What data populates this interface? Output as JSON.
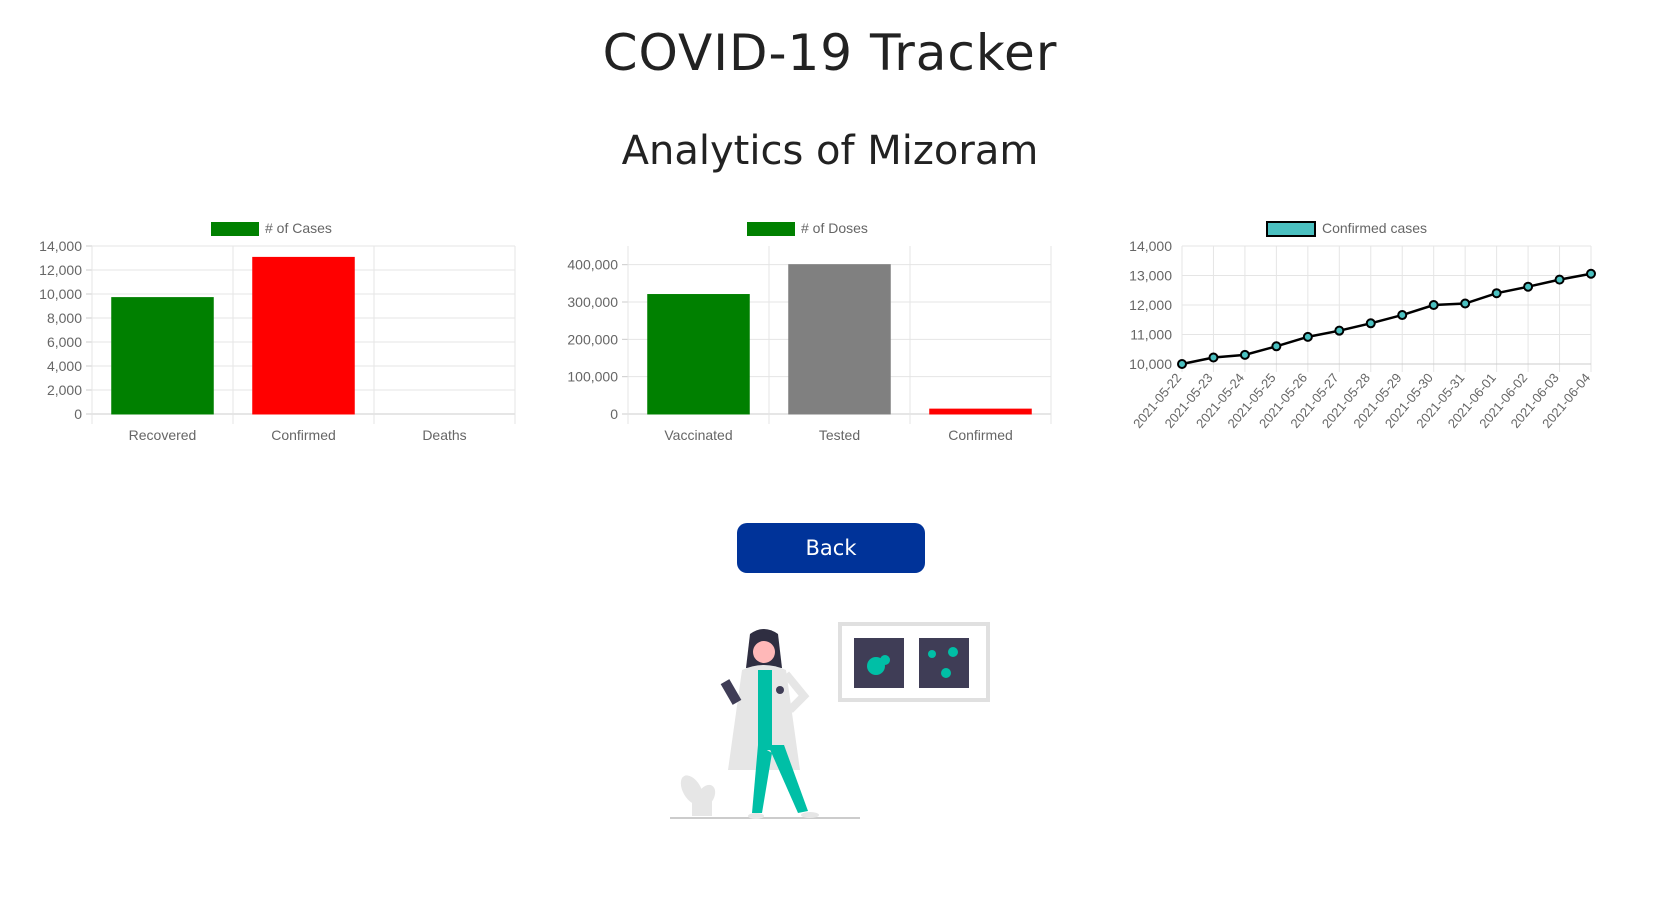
{
  "header": {
    "title": "COVID-19 Tracker",
    "subtitle": "Analytics of Mizoram"
  },
  "actions": {
    "back_label": "Back"
  },
  "colors": {
    "green": "#008000",
    "red": "#ff0000",
    "gray": "#808080",
    "teal": "#4bc0c0",
    "button": "#003399"
  },
  "chart_data": [
    {
      "type": "bar",
      "legend": "# of Cases",
      "categories": [
        "Recovered",
        "Confirmed",
        "Deaths"
      ],
      "values": [
        9700,
        13050,
        0
      ],
      "colors": [
        "#008000",
        "#ff0000",
        "#ff0000"
      ],
      "ylim": [
        0,
        14000
      ],
      "yticks": [
        0,
        2000,
        4000,
        6000,
        8000,
        10000,
        12000,
        14000
      ],
      "legend_position": "top"
    },
    {
      "type": "bar",
      "legend": "# of Doses",
      "categories": [
        "Vaccinated",
        "Tested",
        "Confirmed"
      ],
      "values": [
        320000,
        400000,
        13050
      ],
      "colors": [
        "#008000",
        "#808080",
        "#ff0000"
      ],
      "ylim": [
        0,
        450000
      ],
      "yticks": [
        0,
        100000,
        200000,
        300000,
        400000
      ],
      "legend_position": "top"
    },
    {
      "type": "line",
      "legend": "Confirmed cases",
      "x": [
        "2021-05-22",
        "2021-05-23",
        "2021-05-24",
        "2021-05-25",
        "2021-05-26",
        "2021-05-27",
        "2021-05-28",
        "2021-05-29",
        "2021-05-30",
        "2021-05-31",
        "2021-06-01",
        "2021-06-02",
        "2021-06-03",
        "2021-06-04"
      ],
      "values": [
        10000,
        10220,
        10310,
        10600,
        10920,
        11130,
        11380,
        11660,
        12000,
        12050,
        12400,
        12620,
        12860,
        13060
      ],
      "ylim": [
        10000,
        14000
      ],
      "yticks": [
        10000,
        11000,
        12000,
        13000,
        14000
      ],
      "legend_position": "top"
    }
  ]
}
